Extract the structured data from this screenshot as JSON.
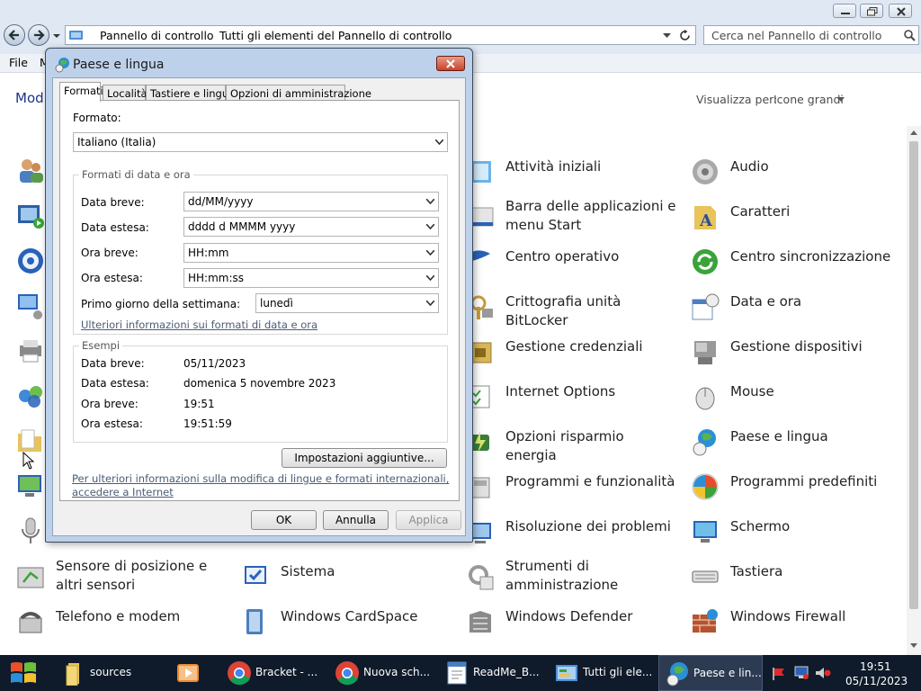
{
  "explorer": {
    "breadcrumb": [
      "Pannello di controllo",
      "Tutti gli elementi del Pannello di controllo"
    ],
    "search_placeholder": "Cerca nel Pannello di controllo",
    "menu": [
      "File",
      "M"
    ],
    "heading": "Mod",
    "view_by_label": "Visualizza per:",
    "view_by_value": "Icone grandi",
    "items": [
      {
        "label": "Attività iniziali",
        "icon": "getting-started-icon"
      },
      {
        "label": "Audio",
        "icon": "speaker-icon"
      },
      {
        "label": "Barra delle applicazioni e menu Start",
        "icon": "taskbar-icon"
      },
      {
        "label": "Caratteri",
        "icon": "fonts-icon"
      },
      {
        "label": "Centro operativo",
        "icon": "flag-icon"
      },
      {
        "label": "Centro sincronizzazione",
        "icon": "sync-icon"
      },
      {
        "label": "Crittografia unità BitLocker",
        "icon": "bitlocker-icon"
      },
      {
        "label": "Data e ora",
        "icon": "calendar-clock-icon"
      },
      {
        "label": "Gestione credenziali",
        "icon": "credential-icon"
      },
      {
        "label": "Gestione dispositivi",
        "icon": "device-manager-icon"
      },
      {
        "label": "Internet Options",
        "icon": "internet-options-icon"
      },
      {
        "label": "Mouse",
        "icon": "mouse-icon"
      },
      {
        "label": "Opzioni risparmio energia",
        "icon": "power-icon"
      },
      {
        "label": "Paese e lingua",
        "icon": "globe-clock-icon"
      },
      {
        "label": "Programmi e funzionalità",
        "icon": "programs-icon"
      },
      {
        "label": "Programmi predefiniti",
        "icon": "default-programs-icon"
      },
      {
        "label": "Risoluzione dei problemi",
        "icon": "troubleshoot-icon"
      },
      {
        "label": "Schermo",
        "icon": "display-icon"
      },
      {
        "label": "Sensore di posizione e altri sensori",
        "icon": "sensor-icon"
      },
      {
        "label": "Sistema",
        "icon": "system-icon"
      },
      {
        "label": "Strumenti di amministrazione",
        "icon": "admin-tools-icon"
      },
      {
        "label": "Tastiera",
        "icon": "keyboard-icon"
      },
      {
        "label": "Telefono e modem",
        "icon": "phone-modem-icon"
      },
      {
        "label": "Windows CardSpace",
        "icon": "cardspace-icon"
      },
      {
        "label": "Windows Defender",
        "icon": "defender-icon"
      },
      {
        "label": "Windows Firewall",
        "icon": "firewall-icon"
      }
    ]
  },
  "dialog": {
    "title": "Paese e lingua",
    "tabs": [
      "Formati",
      "Località",
      "Tastiere e lingue",
      "Opzioni di amministrazione"
    ],
    "format_label": "Formato:",
    "format_value": "Italiano (Italia)",
    "datetime_group_title": "Formati di data e ora",
    "fields": [
      {
        "label": "Data breve:",
        "value": "dd/MM/yyyy"
      },
      {
        "label": "Data estesa:",
        "value": "dddd d MMMM yyyy"
      },
      {
        "label": "Ora breve:",
        "value": "HH:mm"
      },
      {
        "label": "Ora estesa:",
        "value": "HH:mm:ss"
      }
    ],
    "first_day_label": "Primo giorno della settimana:",
    "first_day_value": "lunedì",
    "datetime_link": "Ulteriori informazioni sui formati di data e ora",
    "examples_group_title": "Esempi",
    "examples": [
      {
        "label": "Data breve:",
        "value": "05/11/2023"
      },
      {
        "label": "Data estesa:",
        "value": "domenica 5 novembre 2023"
      },
      {
        "label": "Ora breve:",
        "value": "19:51"
      },
      {
        "label": "Ora estesa:",
        "value": "19:51:59"
      }
    ],
    "additional_settings": "Impostazioni aggiuntive...",
    "bottom_link_line1": "Per ulteriori informazioni sulla modifica di lingue e formati internazionali,",
    "bottom_link_line2": "accedere a Internet",
    "ok": "OK",
    "cancel": "Annulla",
    "apply": "Applica"
  },
  "taskbar": {
    "buttons": [
      {
        "label": "sources",
        "icon": "folder-icon"
      },
      {
        "label": "",
        "icon": "media-player-icon"
      },
      {
        "label": "Bracket - ...",
        "icon": "chrome-icon"
      },
      {
        "label": "Nuova sch...",
        "icon": "chrome-icon"
      },
      {
        "label": "ReadMe_B...",
        "icon": "wordpad-icon"
      },
      {
        "label": "Tutti gli ele...",
        "icon": "control-panel-icon"
      },
      {
        "label": "Paese e lin...",
        "icon": "globe-clock-icon"
      }
    ],
    "time": "19:51",
    "date": "05/11/2023"
  },
  "colors": {
    "explorer_frame": "#dfe8f3",
    "dialog_frame": "#bed1ea",
    "taskbar": "#0f1a2a",
    "close_button": "#c9422a",
    "link": "#4b5c74"
  }
}
